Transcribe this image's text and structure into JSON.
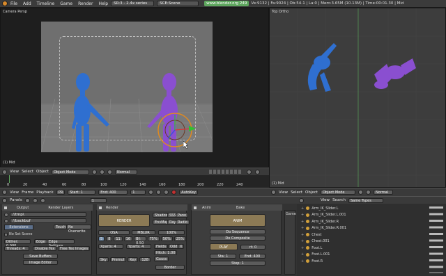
{
  "menubar": {
    "items": [
      "File",
      "Add",
      "Timeline",
      "Game",
      "Render",
      "Help"
    ],
    "screen_field": "SR:3 - 2.4x series",
    "scene_field": "SCE:Scene",
    "url": "www.blender.org 249",
    "stats": "Ve:9132 | Fa:9024 | Ob:54-1 | La:0 | Mem:3.65M (10.13M) | Time:00:01.30 | Mid"
  },
  "viewport_main": {
    "label": "Camera Persp",
    "footer": "(1) Mid",
    "header_items": [
      "View",
      "Select",
      "Object"
    ],
    "mode": "Object Mode",
    "shading": "Normal"
  },
  "viewport_top": {
    "label": "Top Ortho",
    "footer": "(1) Mid",
    "header_items": [
      "View",
      "Select",
      "Object"
    ],
    "mode": "Object Mode",
    "shading": "Normal"
  },
  "timeline": {
    "ticks": [
      "0",
      "20",
      "40",
      "60",
      "80",
      "100",
      "120",
      "140",
      "160",
      "180",
      "200",
      "220",
      "240"
    ],
    "header_items": [
      "View",
      "Frame",
      "Playback"
    ],
    "pr_label": "PR",
    "start": "Start: 1",
    "end": "End: 400",
    "current": "1",
    "autokey": "AutoKey"
  },
  "buttons_header": {
    "items": [
      "Panels"
    ],
    "frame": "1"
  },
  "render_panels": {
    "output_tab": "Output",
    "render_layers_tab": "Render Layers",
    "path1": "//tmp\\",
    "path2": "//backbuf",
    "extensions": "Extensions",
    "touch": "Touch",
    "no_overwrite": "No Overwrite",
    "no_set_scene": "No Set Scene",
    "dither": "Dither: 0.000",
    "edge": "Edge",
    "edge_settings": "Edge Settings",
    "threads": "Threads: 4",
    "disable_tex": "Disable Tex",
    "free_tex_images": "Free Tex Images",
    "save_buffers": "Save Buffers",
    "image_editor": "Image Editor",
    "render_header": "Render",
    "render_btn": "RENDER",
    "shadow": "Shadow",
    "sss": "SSS",
    "pano": "Pano",
    "envmap": "EnvMap",
    "ray": "Ray",
    "radio": "Radio",
    "osa": "OSA",
    "mblur": "MBLUR",
    "percent100": "100%",
    "osa_vals": [
      "5",
      "8",
      "11",
      "16"
    ],
    "bf": "Bf: 0.50",
    "p75": "75%",
    "p50": "50%",
    "p25": "25%",
    "xparts": "Xparts: 4",
    "yparts": "Yparts: 4",
    "fields": "Fields",
    "odd": "Odd",
    "x": "X",
    "gauss": "Gauss",
    "sky": "Sky",
    "premul": "Premul",
    "key": "Key",
    "val128": "128",
    "border": "Border",
    "hitch": "Hitch: 1.00"
  },
  "anim_panel": {
    "anim_tab": "Anim",
    "bake_tab": "Bake",
    "anim_btn": "ANIM",
    "do_sequence": "Do Sequence",
    "do_composite": "Do Composite",
    "play": "PLAY",
    "rt": "rt: 0",
    "sta": "Sta: 1",
    "end": "End: 400",
    "step": "Step: 1",
    "game_label": "Game"
  },
  "outliner": {
    "header_items": [
      "View",
      "Search"
    ],
    "dropdown": "Same Types",
    "items": [
      "Arm_IK_Slider.L",
      "Arm_IK_Slider.L.001",
      "Arm_IK_Slider.R",
      "Arm_IK_Slider.R.001",
      "Chest",
      "Chest.001",
      "Foot.L",
      "Foot.L.001",
      "Foot.R"
    ]
  },
  "colors": {
    "accent_green": "#5ea65e",
    "blue_figure": "#2f6fd0",
    "purple_figure": "#8a4fd0",
    "tan_button": "#8c7a55"
  }
}
